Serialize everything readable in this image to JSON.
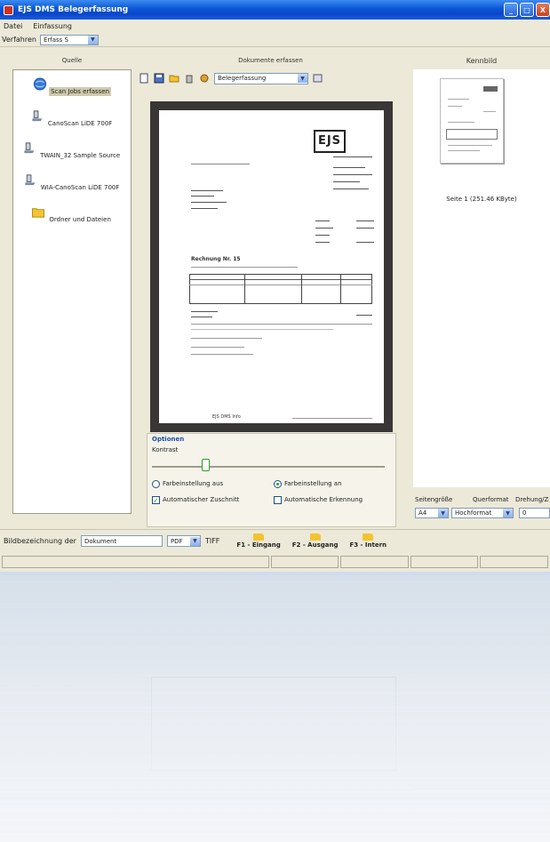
{
  "window": {
    "title": "EJS DMS Belegerfassung",
    "controls": [
      "_",
      "□",
      "X"
    ]
  },
  "menu": [
    "Datei",
    "Einfassung"
  ],
  "modebar": {
    "label": "Verfahren",
    "value": "Erfass S"
  },
  "panels": {
    "source_header": "Quelle",
    "center_header": "Dokumente erfassen",
    "right_header": "Kennbild"
  },
  "sources": [
    {
      "label": "Scan Jobs erfassen",
      "icon": "globe-icon",
      "selected": true
    },
    {
      "label": "CanoScan LiDE 700F",
      "icon": "scanner-icon"
    },
    {
      "label": "TWAIN_32 Sample Source",
      "icon": "scanner-icon"
    },
    {
      "label": "WIA-CanoScan LiDE 700F",
      "icon": "scanner-icon"
    },
    {
      "label": "Ordner und Dateien",
      "icon": "folder-icon"
    }
  ],
  "toolbar": {
    "profile_select": "Belegerfassung"
  },
  "document": {
    "logo": "EJS",
    "heading": "Rechnung Nr. 15",
    "footer": "EJS DMS Info"
  },
  "options": {
    "title": "Optionen",
    "contrast_label": "Kontrast",
    "contrast_value": 0.22,
    "radio_a": "Farbeinstellung aus",
    "radio_b": "Farbeinstellung an",
    "radio_b_selected": true,
    "check_a": "Automatischer Zuschnitt",
    "check_a_checked": true,
    "check_b": "Automatische Erkennung",
    "check_b_checked": false
  },
  "kennbild": {
    "caption": "Seite 1 (251.46 KByte)",
    "paper_size_label": "Seitengröße",
    "orientation_label": "Querformat",
    "rotation_label": "Drehung/Zeile",
    "paper_size_value": "A4",
    "orientation_value": "Hochformat",
    "rotation_value": "0"
  },
  "bottombar": {
    "label": "Bildbezeichnung der",
    "name_value": "Dokument",
    "format_value": "PDF",
    "tiff_label": "TIFF",
    "f1": "F1 - Eingang",
    "f2": "F2 - Ausgang",
    "f3": "F3 - Intern"
  }
}
